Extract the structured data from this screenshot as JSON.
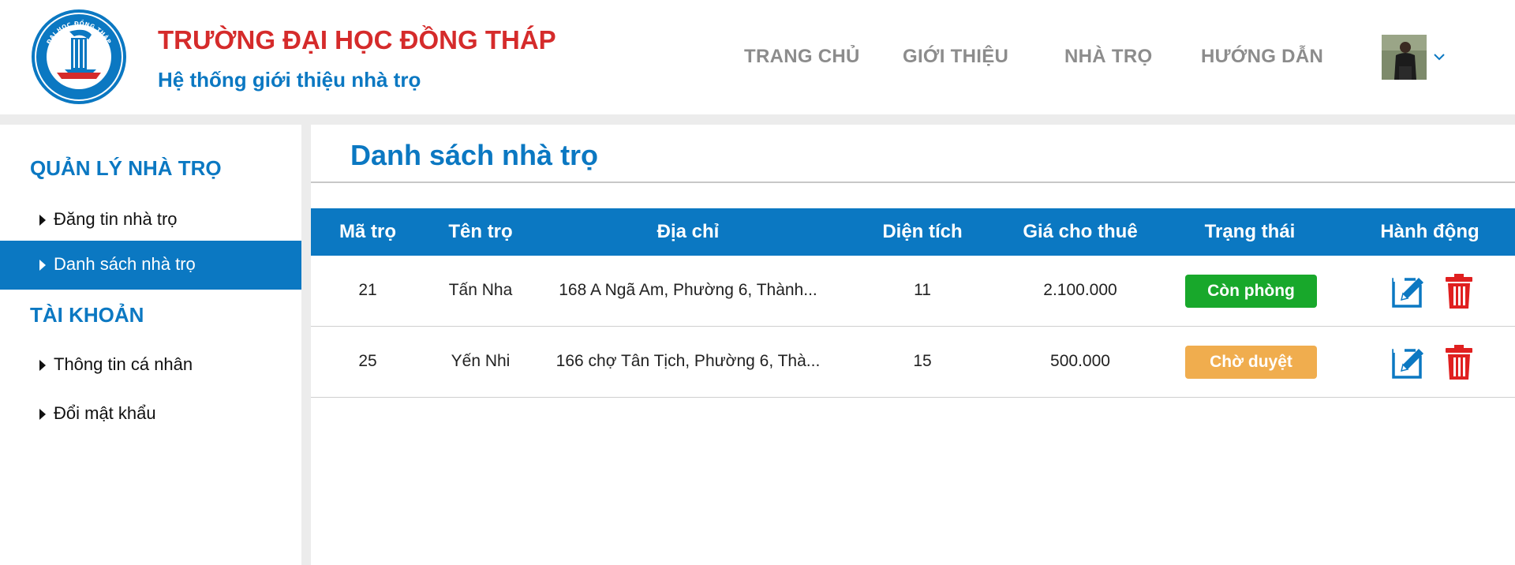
{
  "header": {
    "logo_text_top": "ĐẠI HỌC ĐỒNG THÁP",
    "logo_text_bottom": "DONG THAP UNIVERSITY",
    "title": "TRƯỜNG ĐẠI HỌC ĐỒNG THÁP",
    "subtitle": "Hệ thống giới thiệu nhà trọ",
    "nav": [
      "TRANG CHỦ",
      "GIỚI THIỆU",
      "NHÀ TRỌ",
      "HƯỚNG DẪN"
    ]
  },
  "sidebar": {
    "section1": "QUẢN LÝ NHÀ TRỌ",
    "items1": [
      "Đăng tin nhà trọ",
      "Danh sách nhà trọ"
    ],
    "section2": "TÀI KHOẢN",
    "items2": [
      "Thông tin cá nhân",
      "Đổi mật khẩu"
    ]
  },
  "main": {
    "title": "Danh sách nhà trọ",
    "columns": [
      "Mã trọ",
      "Tên trọ",
      "Địa chỉ",
      "Diện tích",
      "Giá cho thuê",
      "Trạng thái",
      "Hành động"
    ],
    "rows": [
      {
        "id": "21",
        "name": "Tấn Nha",
        "address": "168 A Ngã Am, Phường 6, Thành...",
        "area": "11",
        "price": "2.100.000",
        "status": "Còn phòng"
      },
      {
        "id": "25",
        "name": "Yến Nhi",
        "address": "166 chợ Tân Tịch, Phường 6, Thà...",
        "area": "15",
        "price": "500.000",
        "status": "Chờ duyệt"
      }
    ]
  },
  "colors": {
    "brand_blue": "#0b78c2",
    "brand_red": "#d52b2b",
    "status_available": "#18a82b",
    "status_pending": "#f0ad4e",
    "delete_red": "#e02020"
  },
  "icons": [
    "university-logo",
    "user-avatar",
    "chevron-down-icon",
    "caret-right-icon",
    "edit-icon",
    "trash-icon"
  ]
}
